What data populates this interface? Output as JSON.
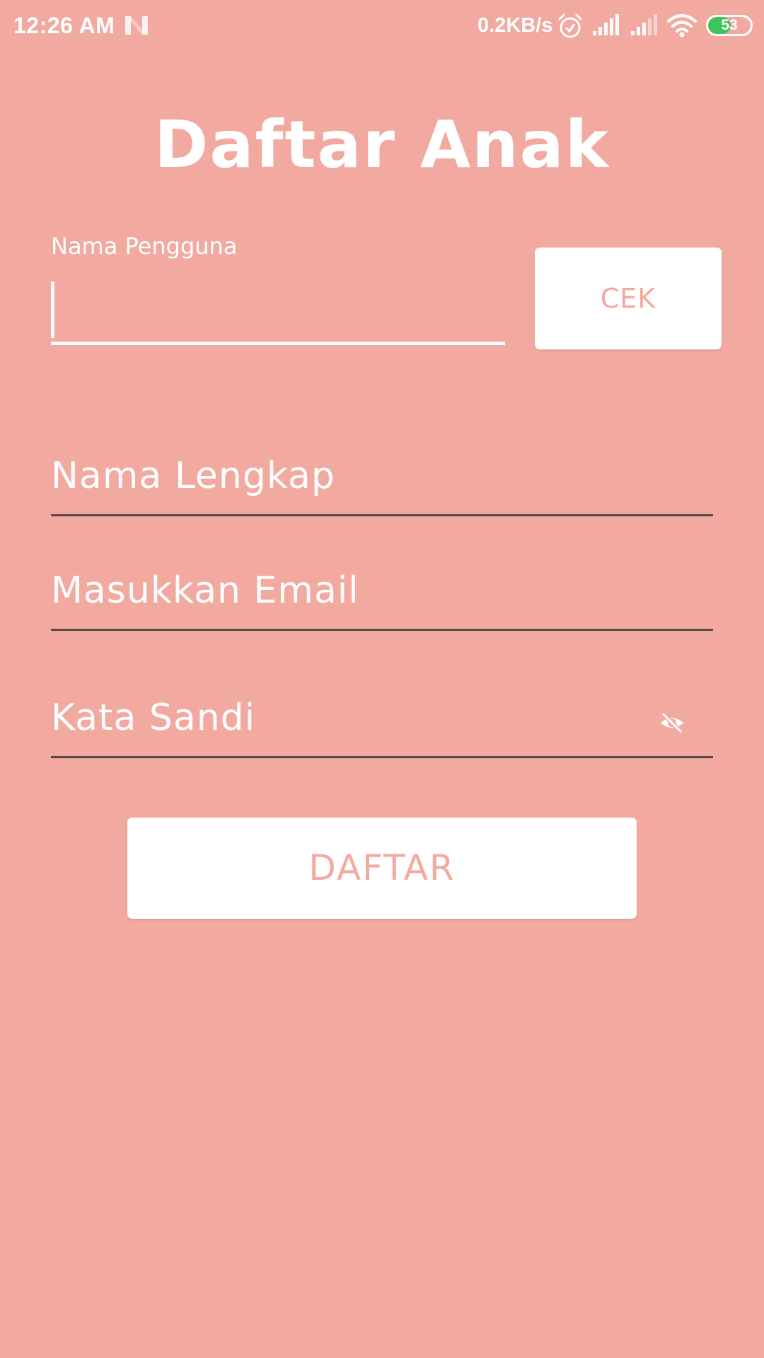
{
  "status_bar": {
    "time": "12:26 AM",
    "network_speed": "0.2KB/s",
    "battery_level": "53",
    "battery_fraction": 0.53,
    "icons": [
      "n-notification-icon",
      "alarm-icon",
      "signal-icon",
      "signal-icon",
      "wifi-icon",
      "battery-icon"
    ]
  },
  "page": {
    "title": "Daftar Anak"
  },
  "form": {
    "username": {
      "label": "Nama Pengguna",
      "value": ""
    },
    "check_button_label": "CEK",
    "full_name_placeholder": "Nama Lengkap",
    "email_placeholder": "Masukkan Email",
    "password_placeholder": "Kata Sandi",
    "password_toggle_icon": "eye-off-icon",
    "submit_label": "DAFTAR"
  },
  "colors": {
    "background": "#f1a9a0",
    "text_on_background": "#ffffff",
    "button_background": "#ffffff",
    "button_text": "#f1a9a0",
    "field_underline": "#5d4747",
    "battery_fill": "#3cc55a"
  }
}
